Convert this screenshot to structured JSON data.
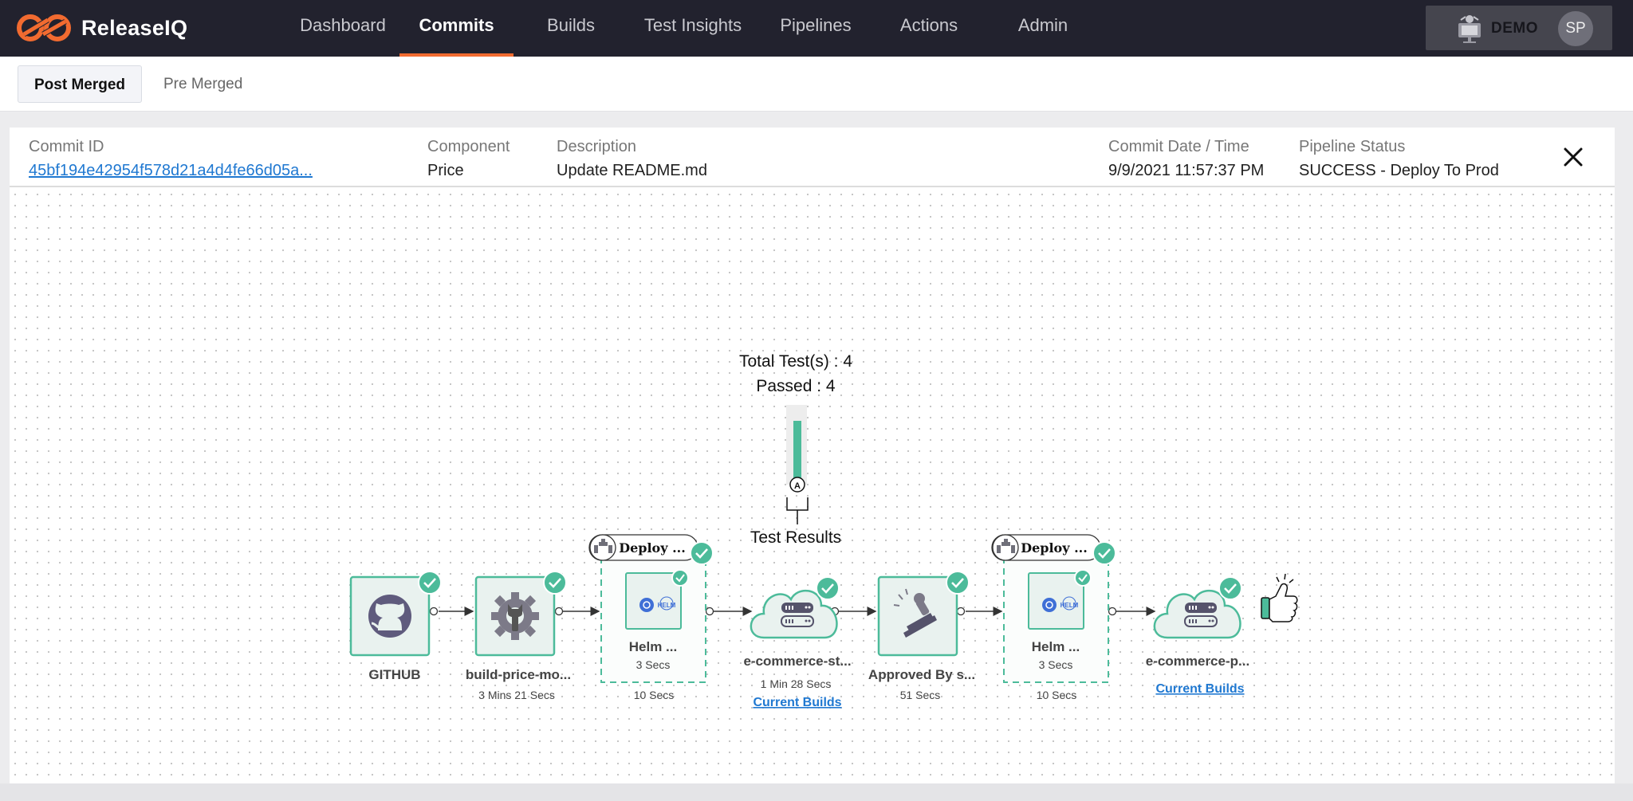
{
  "brand": {
    "name": "ReleaseIQ"
  },
  "nav": {
    "tabs": [
      {
        "label": "Dashboard"
      },
      {
        "label": "Commits"
      },
      {
        "label": "Builds"
      },
      {
        "label": "Test Insights"
      },
      {
        "label": "Pipelines"
      },
      {
        "label": "Actions"
      },
      {
        "label": "Admin"
      }
    ],
    "active": "Commits"
  },
  "account": {
    "env_label": "DEMO",
    "initials": "SP"
  },
  "subtabs": [
    {
      "label": "Post Merged",
      "active": true
    },
    {
      "label": "Pre Merged",
      "active": false
    }
  ],
  "commit": {
    "id_label": "Commit ID",
    "id_value": "45bf194e42954f578d21a4d4fe66d05a...",
    "component_label": "Component",
    "component_value": "Price",
    "description_label": "Description",
    "description_value": "Update README.md",
    "date_label": "Commit Date / Time",
    "date_value": "9/9/2021 11:57:37 PM",
    "status_label": "Pipeline Status",
    "status_value": "SUCCESS - Deploy To Prod"
  },
  "tests": {
    "total_line": "Total Test(s) : 4",
    "passed_line": "Passed : 4",
    "gate_letter": "A",
    "results_label": "Test Results",
    "passed_ratio": 1.0
  },
  "pipeline": {
    "source": {
      "name": "GITHUB"
    },
    "build": {
      "name": "build-price-mo...",
      "time": "3 Mins 21 Secs"
    },
    "deploy_group_1": {
      "title": "Deploy ...",
      "inner_name": "Helm ...",
      "inner_time": "3 Secs",
      "time": "10 Secs"
    },
    "env_1": {
      "name": "e-commerce-st...",
      "time": "1 Min 28 Secs",
      "link": "Current Builds"
    },
    "approval": {
      "name": "Approved By s...",
      "time": "51 Secs"
    },
    "deploy_group_2": {
      "title": "Deploy ...",
      "inner_name": "Helm ...",
      "inner_time": "3 Secs",
      "time": "10 Secs"
    },
    "env_2": {
      "name": "e-commerce-p...",
      "link": "Current Builds"
    },
    "helm_logo_text": "HELM"
  },
  "colors": {
    "accent": "#f26b30",
    "success": "#4cbb9a",
    "link": "#1f78d1",
    "topbar": "#22222e"
  }
}
